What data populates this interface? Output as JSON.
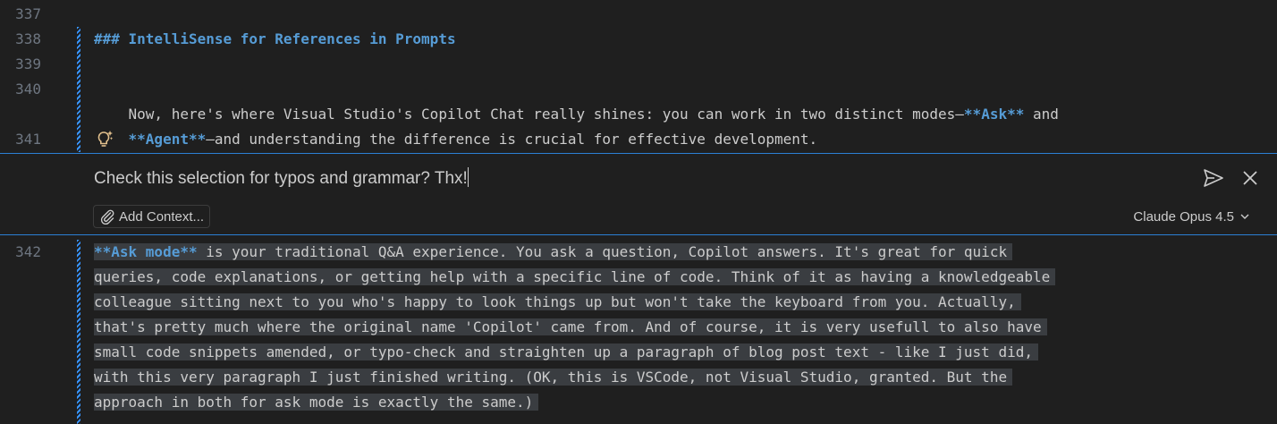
{
  "editor": {
    "lines_before": [
      {
        "no": "337",
        "text": ""
      },
      {
        "no": "338",
        "text": "### IntelliSense for References in Prompts"
      },
      {
        "no": "339",
        "text": ""
      },
      {
        "no": "340",
        "text_parts": [
          {
            "t": "Now, here's where Visual Studio's Copilot Chat really shines: you can work in two distinct modes—",
            "s": "plain"
          },
          {
            "t": "**Ask**",
            "s": "bold"
          },
          {
            "t": " and",
            "s": "plain"
          }
        ]
      },
      {
        "no": "",
        "text_parts": [
          {
            "t": "**Agent**",
            "s": "bold"
          },
          {
            "t": "—and understanding the difference is crucial for effective development.",
            "s": "plain"
          }
        ]
      },
      {
        "no": "341",
        "text": ""
      }
    ],
    "line_342_no": "342",
    "line_342_lines": [
      [
        {
          "t": "**Ask mode**",
          "s": "bold"
        },
        {
          "t": " is your traditional Q&A experience. You ask a question, Copilot answers. It's great for quick",
          "s": "plain"
        }
      ],
      [
        {
          "t": "queries, code explanations, or getting help with a specific line of code. Think of it as having a knowledgeable",
          "s": "plain"
        }
      ],
      [
        {
          "t": "colleague sitting next to you who's happy to look things up but won't take the keyboard from you. Actually,",
          "s": "plain"
        }
      ],
      [
        {
          "t": "that's pretty much where the original name 'Copilot' came from. And of course, it is very usefull to also have",
          "s": "plain"
        }
      ],
      [
        {
          "t": "small code snippets amended, or typo-check and straighten up a paragraph of blog post text - like I just did,",
          "s": "plain"
        }
      ],
      [
        {
          "t": "with this very paragraph I just finished writing. (OK, this is VSCode, not Visual Studio, granted. But the",
          "s": "plain"
        }
      ],
      [
        {
          "t": "approach in both for ask mode is exactly the same.)",
          "s": "plain"
        }
      ]
    ]
  },
  "chat": {
    "input_value": "Check this selection for typos and grammar? Thx!",
    "add_context_label": "Add Context...",
    "model_label": "Claude Opus 4.5",
    "icons": {
      "send": "send-icon",
      "close": "close-icon",
      "attach": "paperclip-icon",
      "chevron": "chevron-down-icon",
      "sparkle": "sparkle-lightbulb-icon"
    }
  },
  "colors": {
    "background": "#1f1f1f",
    "accent": "#2b7fd4",
    "keyword": "#569cd6",
    "bulb": "#e2c08d",
    "selection": "#3a3d41"
  }
}
